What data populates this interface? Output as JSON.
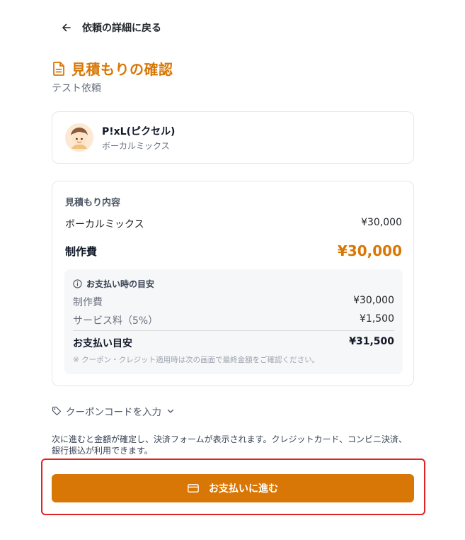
{
  "nav": {
    "back_label": "依頼の詳細に戻る"
  },
  "header": {
    "title": "見積もりの確認",
    "subtitle": "テスト依頼"
  },
  "creator": {
    "name": "P!xL(ピクセル)",
    "role": "ボーカルミックス"
  },
  "estimate": {
    "section_label": "見積もり内容",
    "items": [
      {
        "label": "ボーカルミックス",
        "amount": "¥30,000"
      }
    ],
    "total_label": "制作費",
    "total_amount": "¥30,000",
    "payment_guide": {
      "heading": "お支払い時の目安",
      "rows": [
        {
          "label": "制作費",
          "amount": "¥30,000"
        },
        {
          "label": "サービス料（5%）",
          "amount": "¥1,500"
        }
      ],
      "total_label": "お支払い目安",
      "total_amount": "¥31,500",
      "note": "※ クーポン・クレジット適用時は次の画面で最終金額をご確認ください。"
    }
  },
  "coupon": {
    "label": "クーポンコードを入力"
  },
  "notice": "次に進むと金額が確定し、決済フォームが表示されます。クレジットカード、コンビニ決済、銀行振込が利用できます。",
  "pay_button": {
    "label": "お支払いに進む"
  },
  "colors": {
    "accent": "#d97706",
    "highlight": "#e02424",
    "guide_bg": "#f6f7f8"
  },
  "icons": {
    "back": "arrow-left-icon",
    "title": "document-icon",
    "info": "info-icon",
    "coupon": "tag-icon",
    "expand": "chevron-down-icon",
    "pay": "credit-card-icon"
  }
}
